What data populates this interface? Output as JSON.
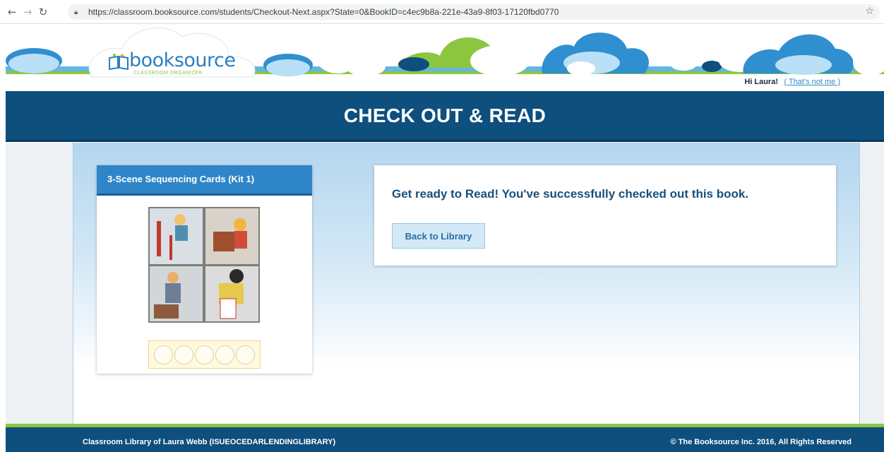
{
  "browser": {
    "url": "https://classroom.booksource.com/students/Checkout-Next.aspx?State=0&BookID=c4ec9b8a-221e-43a9-8f03-17120fbd0770",
    "icons": [
      "back-arrow-icon",
      "forward-arrow-icon",
      "reload-icon",
      "lock-icon",
      "bookmark-star-icon"
    ]
  },
  "header": {
    "logo_word": "booksource",
    "logo_tagline": "CLASSROOM ORGANIZER",
    "greeting": "Hi Laura!",
    "not_me_link": "( That's not me )"
  },
  "page": {
    "title": "CHECK OUT & READ"
  },
  "book": {
    "title": "3-Scene Sequencing Cards (Kit 1)",
    "rating": {
      "max": 5,
      "value": 0
    }
  },
  "message": {
    "text": "Get ready to Read! You've successfully checked out this book.",
    "back_button": "Back to Library"
  },
  "footer": {
    "left": "Classroom Library of Laura Webb (ISUEOCEDARLENDINGLIBRARY)",
    "right": "© The Booksource Inc. 2016, All Rights Reserved"
  },
  "colors": {
    "brand_blue": "#0e4f7e",
    "accent_green": "#8cc63f",
    "link_blue": "#2e8bc9",
    "heading_blue": "#16507e"
  }
}
